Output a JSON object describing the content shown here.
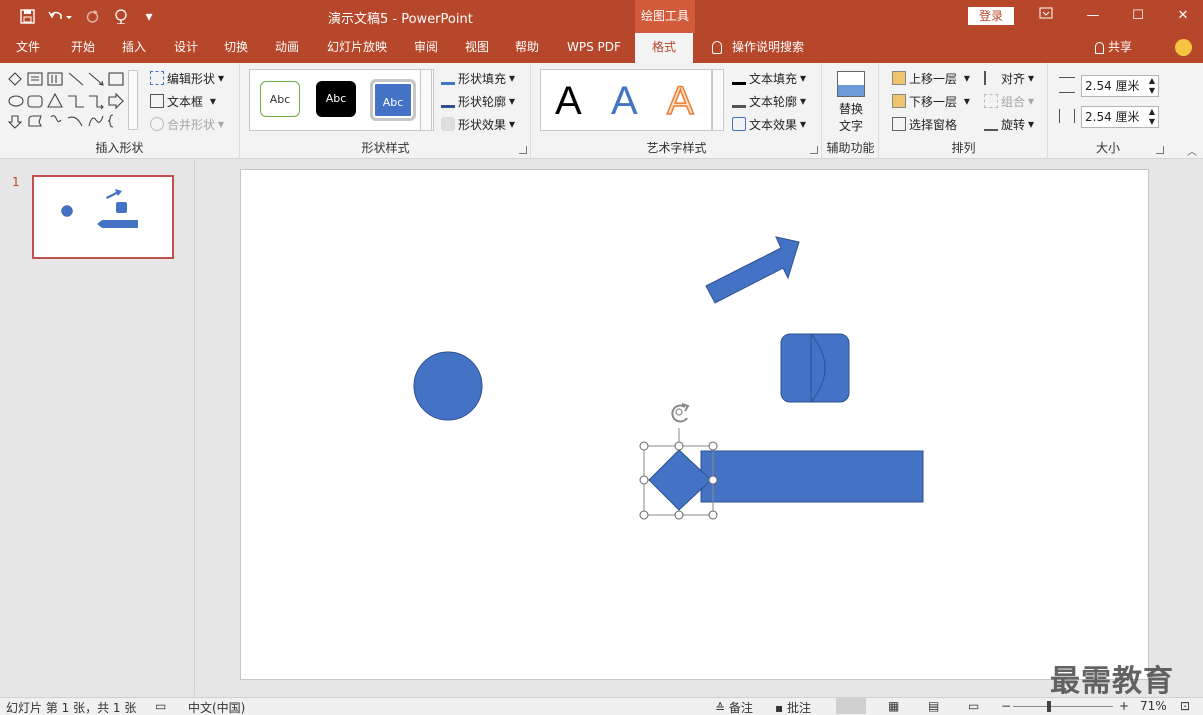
{
  "titlebar": {
    "title": "演示文稿5  -  PowerPoint",
    "context_tab": "绘图工具",
    "login": "登录",
    "restore": "▭",
    "minimize": "—",
    "maximize": "☐",
    "close": "✕",
    "save_icon": "save-icon",
    "undo_icon": "undo-icon",
    "redo_icon": "redo-icon",
    "present_icon": "presenter-icon",
    "customize": "▾"
  },
  "tabs": [
    "文件",
    "开始",
    "插入",
    "设计",
    "切换",
    "动画",
    "幻灯片放映",
    "审阅",
    "视图",
    "帮助",
    "WPS PDF",
    "格式"
  ],
  "active_tab": "格式",
  "tell_me": "操作说明搜索",
  "share": "共享",
  "ribbon": {
    "insert_shapes": {
      "label": "插入形状",
      "edit_shape": "编辑形状",
      "text_box": "文本框",
      "merge_shapes": "合并形状"
    },
    "shape_styles": {
      "label": "形状样式",
      "swatches": [
        "Abc",
        "Abc",
        "Abc"
      ],
      "fill": "形状填充",
      "outline": "形状轮廓",
      "effects": "形状效果"
    },
    "wordart": {
      "label": "艺术字样式",
      "letters": [
        "A",
        "A",
        "A"
      ],
      "text_fill": "文本填充",
      "text_outline": "文本轮廓",
      "text_effects": "文本效果"
    },
    "accessibility": {
      "label": "辅助功能",
      "alt_text_1": "替换",
      "alt_text_2": "文字"
    },
    "arrange": {
      "label": "排列",
      "bring_forward": "上移一层",
      "send_backward": "下移一层",
      "selection_pane": "选择窗格",
      "align": "对齐",
      "group": "组合",
      "rotate": "旋转"
    },
    "size": {
      "label": "大小",
      "height": "2.54 厘米",
      "width": "2.54 厘米"
    }
  },
  "thumbnails": [
    {
      "number": "1"
    }
  ],
  "status": {
    "slide_info": "幻灯片 第 1 张，共 1 张",
    "language": "中文(中国)",
    "notes": "备注",
    "comments": "批注",
    "zoom": "71%",
    "zoom_minus": "−",
    "zoom_plus": "+"
  },
  "colors": {
    "accent": "#b7472a",
    "shape_fill": "#4472c4",
    "shape_stroke": "#2f528f"
  },
  "watermark": "最需教育"
}
